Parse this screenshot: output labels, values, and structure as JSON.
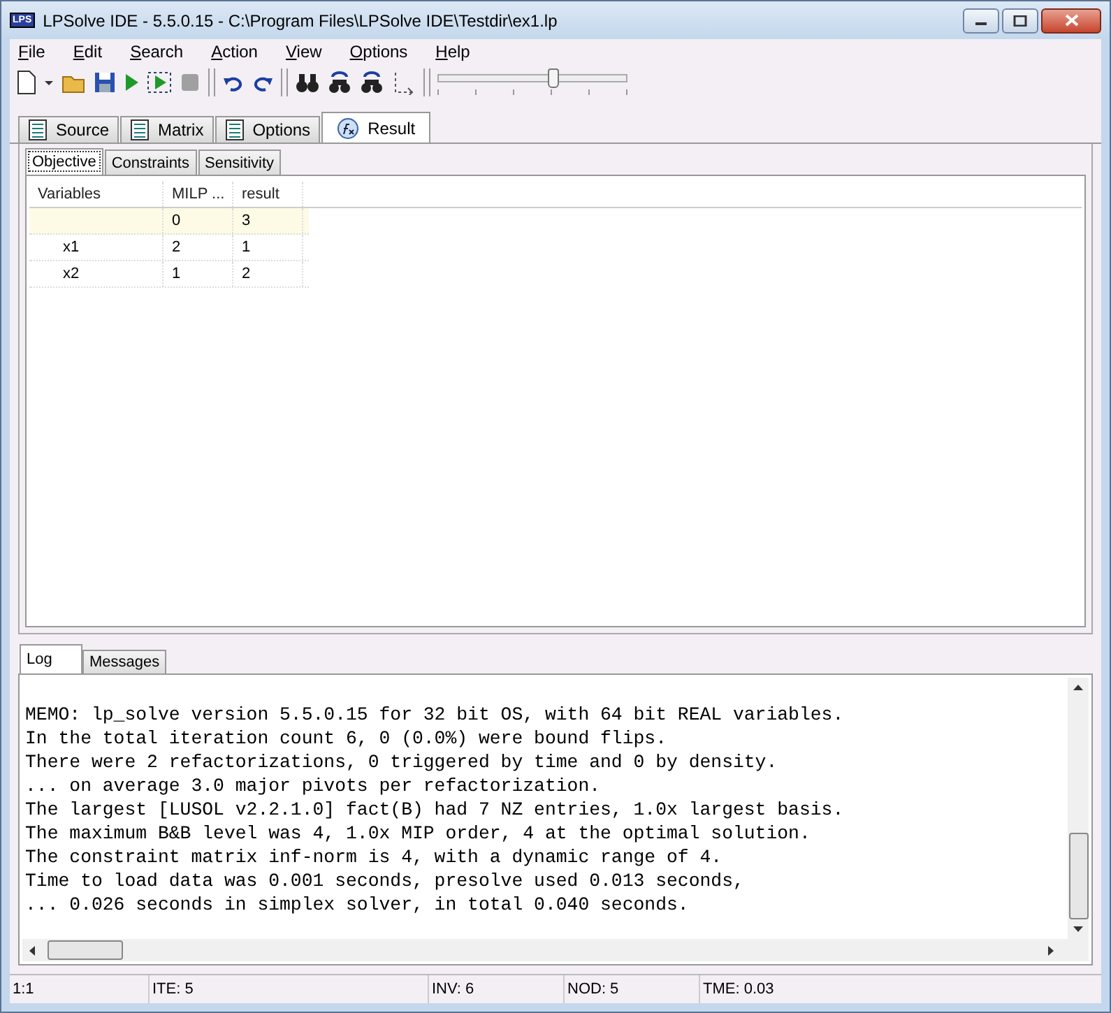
{
  "window": {
    "title": "LPSolve IDE - 5.5.0.15 - C:\\Program Files\\LPSolve IDE\\Testdir\\ex1.lp",
    "app_icon": "LPS"
  },
  "menu": [
    "File",
    "Edit",
    "Search",
    "Action",
    "View",
    "Options",
    "Help"
  ],
  "toolbar": {
    "slider": {
      "level": 0.6
    }
  },
  "tabs": [
    {
      "label": "Source",
      "selected": false
    },
    {
      "label": "Matrix",
      "selected": false
    },
    {
      "label": "Options",
      "selected": false
    },
    {
      "label": "Result",
      "selected": true
    }
  ],
  "subtabs": [
    {
      "label": "Objective",
      "selected": true
    },
    {
      "label": "Constraints",
      "selected": false
    },
    {
      "label": "Sensitivity",
      "selected": false
    }
  ],
  "table": {
    "columns": [
      "Variables",
      "MILP ...",
      "result"
    ],
    "rows": [
      {
        "cells": [
          "",
          "0",
          "3"
        ],
        "selected": true
      },
      {
        "cells": [
          "x1",
          "2",
          "1"
        ],
        "selected": false
      },
      {
        "cells": [
          "x2",
          "1",
          "2"
        ],
        "selected": false
      }
    ]
  },
  "log_tabs": [
    {
      "label": "Log",
      "selected": true
    },
    {
      "label": "Messages",
      "selected": false
    }
  ],
  "log_lines": [
    "MEMO: lp_solve version 5.5.0.15 for 32 bit OS, with 64 bit REAL variables.",
    "In the total iteration count 6, 0 (0.0%) were bound flips.",
    "There were 2 refactorizations, 0 triggered by time and 0 by density.",
    "... on average 3.0 major pivots per refactorization.",
    "The largest [LUSOL v2.2.1.0] fact(B) had 7 NZ entries, 1.0x largest basis.",
    "The maximum B&B level was 4, 1.0x MIP order, 4 at the optimal solution.",
    "The constraint matrix inf-norm is 4, with a dynamic range of 4.",
    "Time to load data was 0.001 seconds, presolve used 0.013 seconds,",
    "... 0.026 seconds in simplex solver, in total 0.040 seconds."
  ],
  "status_bar": [
    "1:1",
    "ITE: 5",
    "INV: 6",
    "NOD: 5",
    "TME: 0.03"
  ]
}
